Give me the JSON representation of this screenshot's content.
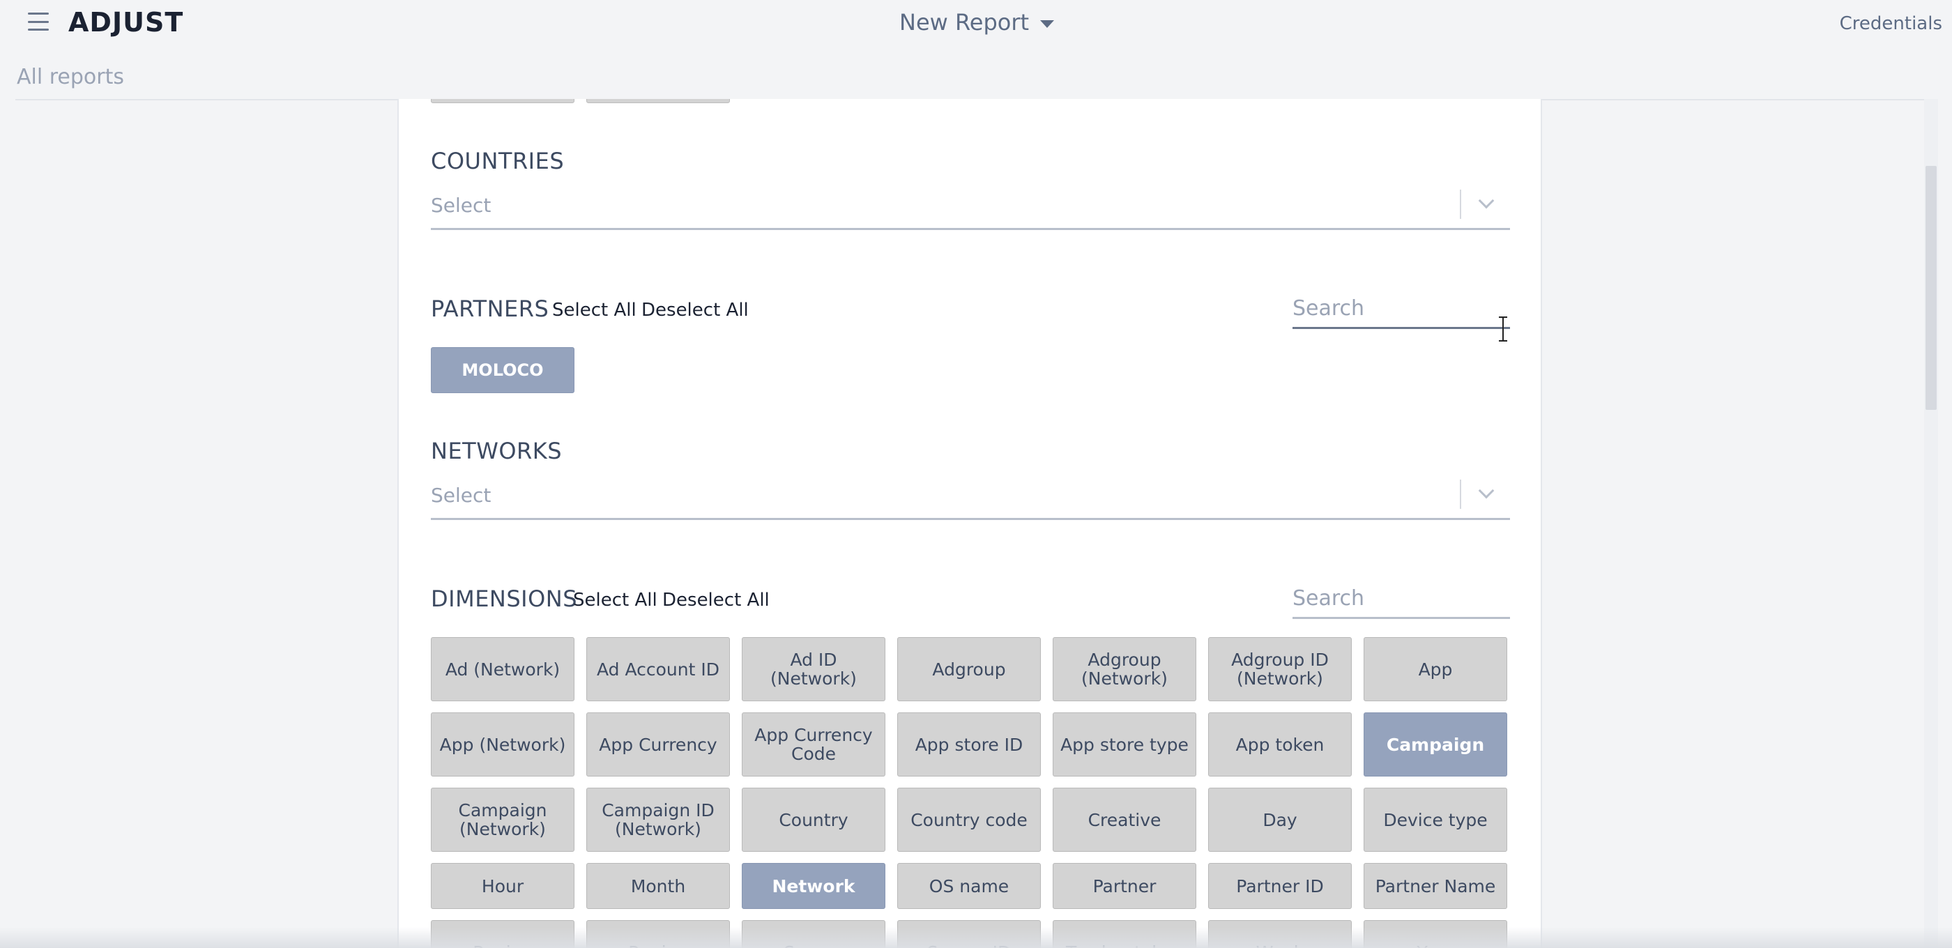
{
  "header": {
    "logo": "ADJUST",
    "title": "New Report",
    "credentials": "Credentials"
  },
  "breadcrumb": "All reports",
  "countries": {
    "title": "COUNTRIES",
    "placeholder": "Select"
  },
  "partners": {
    "title": "PARTNERS",
    "select_all": "Select All",
    "deselect_all": "Deselect All",
    "search_placeholder": "Search",
    "selected": [
      "MOLOCO"
    ]
  },
  "networks": {
    "title": "NETWORKS",
    "placeholder": "Select"
  },
  "dimensions": {
    "title": "DIMENSIONS",
    "select_all": "Select All",
    "deselect_all": "Deselect All",
    "search_placeholder": "Search",
    "items": [
      {
        "label": "Ad (Network)",
        "selected": false
      },
      {
        "label": "Ad Account ID",
        "selected": false
      },
      {
        "label": "Ad ID (Network)",
        "selected": false
      },
      {
        "label": "Adgroup",
        "selected": false
      },
      {
        "label": "Adgroup (Network)",
        "selected": false
      },
      {
        "label": "Adgroup ID (Network)",
        "selected": false
      },
      {
        "label": "App",
        "selected": false
      },
      {
        "label": "App (Network)",
        "selected": false
      },
      {
        "label": "App Currency",
        "selected": false
      },
      {
        "label": "App Currency Code",
        "selected": false
      },
      {
        "label": "App store ID",
        "selected": false
      },
      {
        "label": "App store type",
        "selected": false
      },
      {
        "label": "App token",
        "selected": false
      },
      {
        "label": "Campaign",
        "selected": true
      },
      {
        "label": "Campaign (Network)",
        "selected": false
      },
      {
        "label": "Campaign ID (Network)",
        "selected": false
      },
      {
        "label": "Country",
        "selected": false
      },
      {
        "label": "Country code",
        "selected": false
      },
      {
        "label": "Creative",
        "selected": false
      },
      {
        "label": "Day",
        "selected": false
      },
      {
        "label": "Device type",
        "selected": false
      },
      {
        "label": "Hour",
        "selected": false
      },
      {
        "label": "Month",
        "selected": false
      },
      {
        "label": "Network",
        "selected": true
      },
      {
        "label": "OS name",
        "selected": false
      },
      {
        "label": "Partner",
        "selected": false
      },
      {
        "label": "Partner ID",
        "selected": false
      },
      {
        "label": "Partner Name",
        "selected": false
      },
      {
        "label": "Region",
        "selected": false
      },
      {
        "label": "Region",
        "selected": false
      },
      {
        "label": "Source",
        "selected": false
      },
      {
        "label": "Source ID",
        "selected": false
      },
      {
        "label": "Tracker token",
        "selected": false
      },
      {
        "label": "Week",
        "selected": false
      },
      {
        "label": "Year",
        "selected": false
      }
    ]
  }
}
